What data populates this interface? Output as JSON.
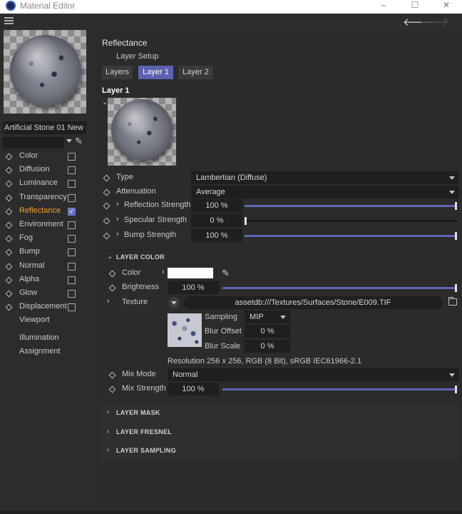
{
  "window": {
    "title": "Material Editor",
    "minimize": "–",
    "maximize": "☐",
    "close": "✕"
  },
  "toolbar": {
    "back": "🡐",
    "forward": "🡒",
    "up": "🡑"
  },
  "material": {
    "name": "Artificial Stone 01 New"
  },
  "channels": [
    {
      "label": "Color",
      "checked": false
    },
    {
      "label": "Diffusion",
      "checked": false
    },
    {
      "label": "Luminance",
      "checked": false
    },
    {
      "label": "Transparency",
      "checked": false
    },
    {
      "label": "Reflectance",
      "checked": true
    },
    {
      "label": "Environment",
      "checked": false
    },
    {
      "label": "Fog",
      "checked": false
    },
    {
      "label": "Bump",
      "checked": false
    },
    {
      "label": "Normal",
      "checked": false
    },
    {
      "label": "Alpha",
      "checked": false
    },
    {
      "label": "Glow",
      "checked": false
    },
    {
      "label": "Displacement",
      "checked": false
    }
  ],
  "extra_nav": {
    "viewport": "Viewport",
    "illumination": "Illumination",
    "assignment": "Assignment"
  },
  "reflectance": {
    "title": "Reflectance",
    "layer_setup": "Layer Setup",
    "tabs": [
      "Layers",
      "Layer 1",
      "Layer 2"
    ],
    "layer_title": "Layer 1",
    "type_label": "Type",
    "type_value": "Lambertian (Diffuse)",
    "attenuation_label": "Attenuation",
    "attenuation_value": "Average",
    "reflection_strength_label": "Reflection Strength",
    "reflection_strength_value": "100 %",
    "reflection_strength_level": 1.0,
    "specular_strength_label": "Specular Strength",
    "specular_strength_value": "0 %",
    "specular_strength_level": 0.0,
    "bump_strength_label": "Bump Strength",
    "bump_strength_value": "100 %",
    "bump_strength_level": 1.0
  },
  "layer_color": {
    "header": "LAYER COLOR",
    "color_label": "Color",
    "color_value": "#ffffff",
    "brightness_label": "Brightness",
    "brightness_value": "100 %",
    "brightness_level": 1.0,
    "texture_label": "Texture",
    "texture_path": "assetdb:///Textures/Surfaces/Stone/E009.TIF",
    "sampling_label": "Sampling",
    "sampling_value": "MIP",
    "blur_offset_label": "Blur Offset",
    "blur_offset_value": "0 %",
    "blur_scale_label": "Blur Scale",
    "blur_scale_value": "0 %",
    "resolution": "Resolution 256 x 256, RGB (8 Bit), sRGB IEC61966-2.1",
    "mix_mode_label": "Mix Mode",
    "mix_mode_value": "Normal",
    "mix_strength_label": "Mix Strength",
    "mix_strength_value": "100 %",
    "mix_strength_level": 1.0
  },
  "groups": {
    "mask": "LAYER MASK",
    "fresnel": "LAYER FRESNEL",
    "sampling": "LAYER SAMPLING"
  },
  "colors": {
    "accent": "#5e66b8",
    "active_channel": "#f0a030",
    "background": "#2b2b2b"
  }
}
